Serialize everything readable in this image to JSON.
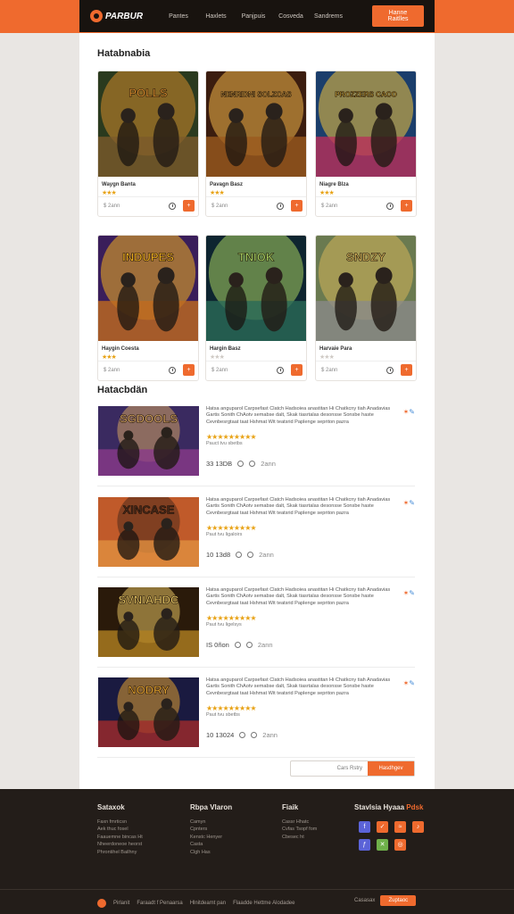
{
  "colors": {
    "accent": "#ef6a2e",
    "dark": "#18130f",
    "star": "#e8a317"
  },
  "nav": {
    "logo": "PARBUR",
    "links": [
      "Pantes",
      "Haxlets",
      "Panjpuis",
      "Cosveda",
      "Sandrems"
    ],
    "cta": "Hanne Raitlles"
  },
  "featured": {
    "title": "Hatabnabia",
    "cards": [
      {
        "name": "Waygn Banta",
        "stars": 3,
        "price": "$ 2ann",
        "art": "POLLS",
        "palette": [
          "#2a3a1e",
          "#7a5a2a",
          "#d28a2c"
        ]
      },
      {
        "name": "Pavagn Basz",
        "stars": 3,
        "price": "$ 2ann",
        "art": "NENRIDNI SOLZCAS",
        "palette": [
          "#3b1d0f",
          "#9a5a1e",
          "#f0b54a"
        ]
      },
      {
        "name": "Niagre Blza",
        "stars": 3,
        "price": "$ 2ann",
        "art": "PROZZERS CACO",
        "palette": [
          "#1b3e6b",
          "#b8305a",
          "#f2c23c"
        ]
      },
      {
        "name": "Haygin Coesta",
        "stars": 4,
        "price": "$ 2ann",
        "art": "INDUPES",
        "palette": [
          "#3a1e5a",
          "#c06a1e",
          "#f0b020"
        ]
      },
      {
        "name": "Hargin Basz",
        "stars": 0,
        "price": "$ 2ann",
        "art": "TNIOK",
        "palette": [
          "#0e2530",
          "#2a6a58",
          "#a8d060"
        ]
      },
      {
        "name": "Harvaie Para",
        "stars": 0,
        "price": "$ 2ann",
        "art": "SNDZY",
        "palette": [
          "#6a7a50",
          "#8a8a88",
          "#d4b45a"
        ]
      }
    ]
  },
  "list": {
    "title": "Hatacbdän",
    "rows": [
      {
        "art": "SGDOOLS",
        "meta": "33 13DB",
        "time": "2ann",
        "sub": "Pauct tvu sbetbs",
        "palette": [
          "#3a2a60",
          "#8a3a8a",
          "#d0a060"
        ]
      },
      {
        "art": "XINCASE",
        "meta": "10 13d8",
        "time": "2ann",
        "sub": "Paut tvu ligaloirs",
        "palette": [
          "#c05a2a",
          "#e09040",
          "#4a2a1a"
        ]
      },
      {
        "art": "SVNIAHDC",
        "meta": "IS 0ñon",
        "time": "2ann",
        "sub": "Paut tvu ligelsys",
        "palette": [
          "#2a1a0a",
          "#b08020",
          "#e0c060"
        ]
      },
      {
        "art": "NODRY",
        "meta": "10 13024",
        "time": "2ann",
        "sub": "Paut tvu sbetbs",
        "palette": [
          "#1a1a40",
          "#a02a2a",
          "#e0a030"
        ]
      }
    ],
    "desc": "Hatsa anguparol Carpsefast Clatch Hadsoiea anastitan Hi Chatkcny tiah Anadavias Gartis Sonith ChAotv semabse dalt, Skak tiasrtalas desonsse Sonsbe haste Cevnbesrgtaat taat Hshmat Wit teatsrid Paplenge sepriton pazra"
  },
  "load_more": {
    "placeholder": "Cars Rstry",
    "button": "Hasdhgev"
  },
  "footer": {
    "col1": {
      "head": "Sataxok",
      "links": [
        "Faxn fmrticsn",
        "Aek thuc fosel",
        "Faauemne bincas Ht",
        "Nheerdoneoe heorst",
        "Phrontihel Bailhny"
      ]
    },
    "col2": {
      "head": "Rbpa Vlaron",
      "links": [
        "Camyn",
        "Cpnters",
        "Kenstc Henyer",
        "Casta",
        "Clgh Has"
      ]
    },
    "col3": {
      "head": "Fiaik",
      "links": [
        "Cassr Hhatc",
        "Cvfas Tsopf fom",
        "Cbesec ht"
      ]
    },
    "social_head": "Stavlsia Hyaaa",
    "social_tag": "Pdsk",
    "bottom_links": [
      "Pirlanit",
      "Faraadt f Penaarsa",
      "Hlnitdeamt pan",
      "Flaadde Hettme Alodadee"
    ],
    "bottom_right": "Casasax",
    "bottom_btn": "Zuptaoc"
  }
}
